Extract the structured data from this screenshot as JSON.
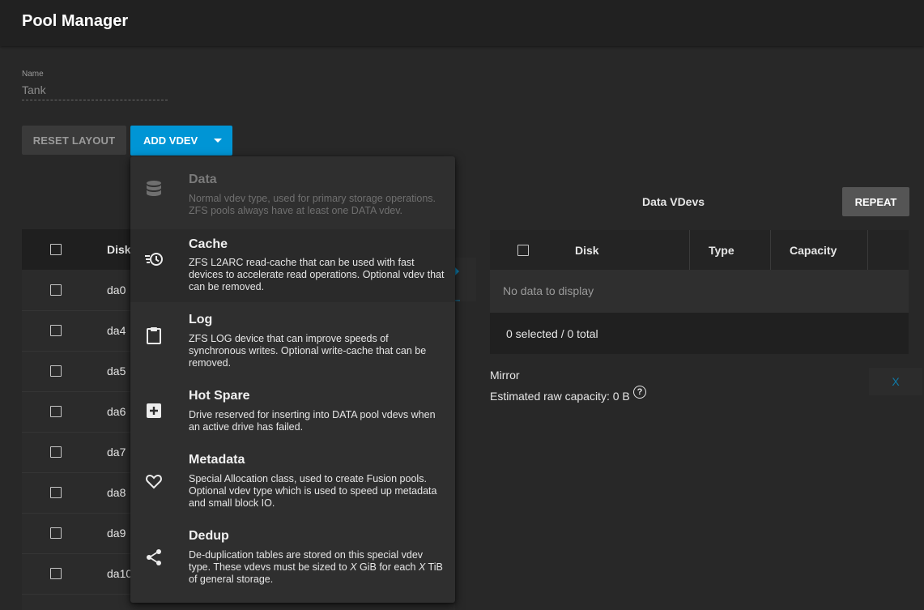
{
  "header": {
    "title": "Pool Manager"
  },
  "name_field": {
    "label": "Name",
    "value": "Tank"
  },
  "toolbar": {
    "reset_label": "RESET LAYOUT",
    "add_vdev_label": "ADD VDEV"
  },
  "available_disks": {
    "header_disk": "Disk",
    "rows": [
      "da0",
      "da4",
      "da5",
      "da6",
      "da7",
      "da8",
      "da9",
      "da10"
    ]
  },
  "data_vdevs": {
    "title": "Data VDevs",
    "repeat_label": "REPEAT",
    "columns": [
      "Disk",
      "Type",
      "Capacity"
    ],
    "empty_text": "No data to display",
    "footer_text": "0 selected / 0 total",
    "layout_text": "Mirror",
    "capacity_text": "Estimated raw capacity: 0 B",
    "remove_label": "X"
  },
  "menu": {
    "items": [
      {
        "title": "Data",
        "icon": "database-icon",
        "desc": "Normal vdev type, used for primary storage operations. ZFS pools always have at least one DATA vdev.",
        "disabled": true
      },
      {
        "title": "Cache",
        "icon": "clock-cache-icon",
        "desc": "ZFS L2ARC read-cache that can be used with fast devices to accelerate read operations. Optional vdev that can be removed.",
        "disabled": false
      },
      {
        "title": "Log",
        "icon": "clipboard-icon",
        "desc": "ZFS LOG device that can improve speeds of synchronous writes. Optional write-cache that can be removed.",
        "disabled": false
      },
      {
        "title": "Hot Spare",
        "icon": "plus-box-icon",
        "desc": "Drive reserved for inserting into DATA pool vdevs when an active drive has failed.",
        "disabled": false
      },
      {
        "title": "Metadata",
        "icon": "heart-icon",
        "desc": "Special Allocation class, used to create Fusion pools. Optional vdev type which is used to speed up metadata and small block IO.",
        "disabled": false
      },
      {
        "title": "Dedup",
        "icon": "share-icon",
        "desc_before": "De-duplication tables are stored on this special vdev type. These vdevs must be sized to ",
        "desc_x1": "X",
        "desc_mid": " GiB for each ",
        "desc_x2": "X",
        "desc_after": " TiB of general storage.",
        "disabled": false
      }
    ]
  },
  "colors": {
    "accent": "#0095d5",
    "background": "#282828",
    "menu": "#2f2f2f"
  }
}
